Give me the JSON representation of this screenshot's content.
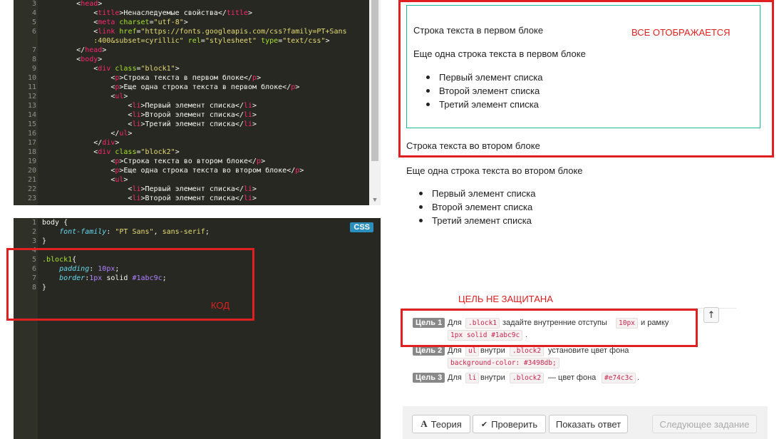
{
  "html_editor": {
    "lines": [
      {
        "n": "3",
        "segs": [
          [
            "w",
            "        <"
          ],
          [
            "t",
            "head"
          ],
          [
            "w",
            ">"
          ]
        ]
      },
      {
        "n": "4",
        "segs": [
          [
            "w",
            "            <"
          ],
          [
            "t",
            "title"
          ],
          [
            "w",
            ">Ненаследуемые свойства</"
          ],
          [
            "t",
            "title"
          ],
          [
            "w",
            ">"
          ]
        ]
      },
      {
        "n": "5",
        "segs": [
          [
            "w",
            "            <"
          ],
          [
            "t",
            "meta"
          ],
          [
            "w",
            " "
          ],
          [
            "a",
            "charset"
          ],
          [
            "w",
            "="
          ],
          [
            "s",
            "\"utf-8\""
          ],
          [
            "w",
            ">"
          ]
        ]
      },
      {
        "n": "6",
        "segs": [
          [
            "w",
            "            <"
          ],
          [
            "t",
            "link"
          ],
          [
            "w",
            " "
          ],
          [
            "a",
            "href"
          ],
          [
            "w",
            "="
          ],
          [
            "s",
            "\"https://fonts.googleapis.com/css?family=PT+Sans"
          ]
        ]
      },
      {
        "n": "",
        "segs": [
          [
            "s",
            "            :400&subset=cyrillic\""
          ],
          [
            "w",
            " "
          ],
          [
            "a",
            "rel"
          ],
          [
            "w",
            "="
          ],
          [
            "s",
            "\"stylesheet\""
          ],
          [
            "w",
            " "
          ],
          [
            "a",
            "type"
          ],
          [
            "w",
            "="
          ],
          [
            "s",
            "\"text/css\""
          ],
          [
            "w",
            ">"
          ]
        ]
      },
      {
        "n": "7",
        "segs": [
          [
            "w",
            "        </"
          ],
          [
            "t",
            "head"
          ],
          [
            "w",
            ">"
          ]
        ]
      },
      {
        "n": "8",
        "segs": [
          [
            "w",
            "        <"
          ],
          [
            "t",
            "body"
          ],
          [
            "w",
            ">"
          ]
        ]
      },
      {
        "n": "9",
        "segs": [
          [
            "w",
            "            <"
          ],
          [
            "t",
            "div"
          ],
          [
            "w",
            " "
          ],
          [
            "a",
            "class"
          ],
          [
            "w",
            "="
          ],
          [
            "s",
            "\"block1\""
          ],
          [
            "w",
            ">"
          ]
        ]
      },
      {
        "n": "10",
        "segs": [
          [
            "w",
            "                <"
          ],
          [
            "t",
            "p"
          ],
          [
            "w",
            ">Строка текста в первом блоке</"
          ],
          [
            "t",
            "p"
          ],
          [
            "w",
            ">"
          ]
        ]
      },
      {
        "n": "11",
        "segs": [
          [
            "w",
            "                <"
          ],
          [
            "t",
            "p"
          ],
          [
            "w",
            ">Еще одна строка текста в первом блоке</"
          ],
          [
            "t",
            "p"
          ],
          [
            "w",
            ">"
          ]
        ]
      },
      {
        "n": "12",
        "segs": [
          [
            "w",
            "                <"
          ],
          [
            "t",
            "ul"
          ],
          [
            "w",
            ">"
          ]
        ]
      },
      {
        "n": "13",
        "segs": [
          [
            "w",
            "                    <"
          ],
          [
            "t",
            "li"
          ],
          [
            "w",
            ">Первый элемент списка</"
          ],
          [
            "t",
            "li"
          ],
          [
            "w",
            ">"
          ]
        ]
      },
      {
        "n": "14",
        "segs": [
          [
            "w",
            "                    <"
          ],
          [
            "t",
            "li"
          ],
          [
            "w",
            ">Второй элемент списка</"
          ],
          [
            "t",
            "li"
          ],
          [
            "w",
            ">"
          ]
        ]
      },
      {
        "n": "15",
        "segs": [
          [
            "w",
            "                    <"
          ],
          [
            "t",
            "li"
          ],
          [
            "w",
            ">Третий элемент списка</"
          ],
          [
            "t",
            "li"
          ],
          [
            "w",
            ">"
          ]
        ]
      },
      {
        "n": "16",
        "segs": [
          [
            "w",
            "                </"
          ],
          [
            "t",
            "ul"
          ],
          [
            "w",
            ">"
          ]
        ]
      },
      {
        "n": "17",
        "segs": [
          [
            "w",
            "            </"
          ],
          [
            "t",
            "div"
          ],
          [
            "w",
            ">"
          ]
        ]
      },
      {
        "n": "18",
        "segs": [
          [
            "w",
            "            <"
          ],
          [
            "t",
            "div"
          ],
          [
            "w",
            " "
          ],
          [
            "a",
            "class"
          ],
          [
            "w",
            "="
          ],
          [
            "s",
            "\"block2\""
          ],
          [
            "w",
            ">"
          ]
        ]
      },
      {
        "n": "19",
        "segs": [
          [
            "w",
            "                <"
          ],
          [
            "t",
            "p"
          ],
          [
            "w",
            ">Строка текста во втором блоке</"
          ],
          [
            "t",
            "p"
          ],
          [
            "w",
            ">"
          ]
        ]
      },
      {
        "n": "20",
        "segs": [
          [
            "w",
            "                <"
          ],
          [
            "t",
            "p"
          ],
          [
            "w",
            ">Еще одна строка текста во втором блоке</"
          ],
          [
            "t",
            "p"
          ],
          [
            "w",
            ">"
          ]
        ]
      },
      {
        "n": "21",
        "segs": [
          [
            "w",
            "                <"
          ],
          [
            "t",
            "ul"
          ],
          [
            "w",
            ">"
          ]
        ]
      },
      {
        "n": "22",
        "segs": [
          [
            "w",
            "                    <"
          ],
          [
            "t",
            "li"
          ],
          [
            "w",
            ">Первый элемент списка</"
          ],
          [
            "t",
            "li"
          ],
          [
            "w",
            ">"
          ]
        ]
      },
      {
        "n": "23",
        "segs": [
          [
            "w",
            "                    <"
          ],
          [
            "t",
            "li"
          ],
          [
            "w",
            ">Второй элемент списка</"
          ],
          [
            "t",
            "li"
          ],
          [
            "w",
            ">"
          ]
        ]
      }
    ]
  },
  "css_editor": {
    "badge": "CSS",
    "lines": [
      {
        "n": "1",
        "segs": [
          [
            "w",
            "body {"
          ]
        ]
      },
      {
        "n": "2",
        "segs": [
          [
            "p",
            "    font-family"
          ],
          [
            "w",
            ": "
          ],
          [
            "s",
            "\"PT Sans\""
          ],
          [
            "w",
            ", "
          ],
          [
            "s",
            "sans-serif"
          ],
          [
            "w",
            ";"
          ]
        ]
      },
      {
        "n": "3",
        "segs": [
          [
            "w",
            "}"
          ]
        ]
      },
      {
        "n": "4",
        "segs": []
      },
      {
        "n": "5",
        "segs": [
          [
            "a",
            ".block1"
          ],
          [
            "w",
            "{"
          ]
        ]
      },
      {
        "n": "6",
        "segs": [
          [
            "p",
            "    padding"
          ],
          [
            "w",
            ": "
          ],
          [
            "n",
            "10px"
          ],
          [
            "w",
            ";"
          ]
        ]
      },
      {
        "n": "7",
        "segs": [
          [
            "p",
            "    border"
          ],
          [
            "w",
            ":"
          ],
          [
            "n",
            "1px"
          ],
          [
            "w",
            " solid "
          ],
          [
            "n",
            "#1abc9c"
          ],
          [
            "w",
            ";"
          ]
        ]
      },
      {
        "n": "8",
        "segs": [
          [
            "w",
            "}"
          ]
        ]
      }
    ],
    "note": "КОД"
  },
  "preview": {
    "note": "ВСЕ ОТОБРАЖАЕТСЯ",
    "block1": {
      "p1": "Строка текста в первом блоке",
      "p2": "Еще одна строка текста в первом блоке",
      "items": [
        "Первый элемент списка",
        "Второй элемент списка",
        "Третий элемент списка"
      ]
    },
    "block2": {
      "p1": "Строка текста во втором блоке",
      "p2": "Еще одна строка текста во втором блоке",
      "items": [
        "Первый элемент списка",
        "Второй элемент списка",
        "Третий элемент списка"
      ]
    }
  },
  "goals": {
    "note": "ЦЕЛЬ НЕ ЗАЩИТАНА",
    "g1": {
      "badge": "Цель 1",
      "t1": "Для",
      "c1": ".block1",
      "t2": "задайте внутренние отступы",
      "c2": "10px",
      "t3": "и рамку",
      "c3": "1px solid #1abc9c",
      "t4": "."
    },
    "g2": {
      "badge": "Цель 2",
      "t1": "Для",
      "c1": "ul",
      "t2": "внутри",
      "c2": ".block2",
      "t3": "установите цвет фона",
      "c3": "background-color: #3498db;"
    },
    "g3": {
      "badge": "Цель 3",
      "t1": "Для",
      "c1": "li",
      "t2": "внутри",
      "c2": ".block2",
      "t3": "— цвет фона",
      "c3": "#e74c3c",
      "t4": "."
    },
    "up_icon": "↑"
  },
  "buttons": {
    "theory": "Теория",
    "theory_icon": "A",
    "check": "Проверить",
    "check_icon": "✔",
    "show_answer": "Показать ответ",
    "next_task": "Следующее задание"
  },
  "colors": {
    "accent_border": "#1abc9c",
    "alert_red": "#e02020",
    "editor_bg": "#272822"
  }
}
